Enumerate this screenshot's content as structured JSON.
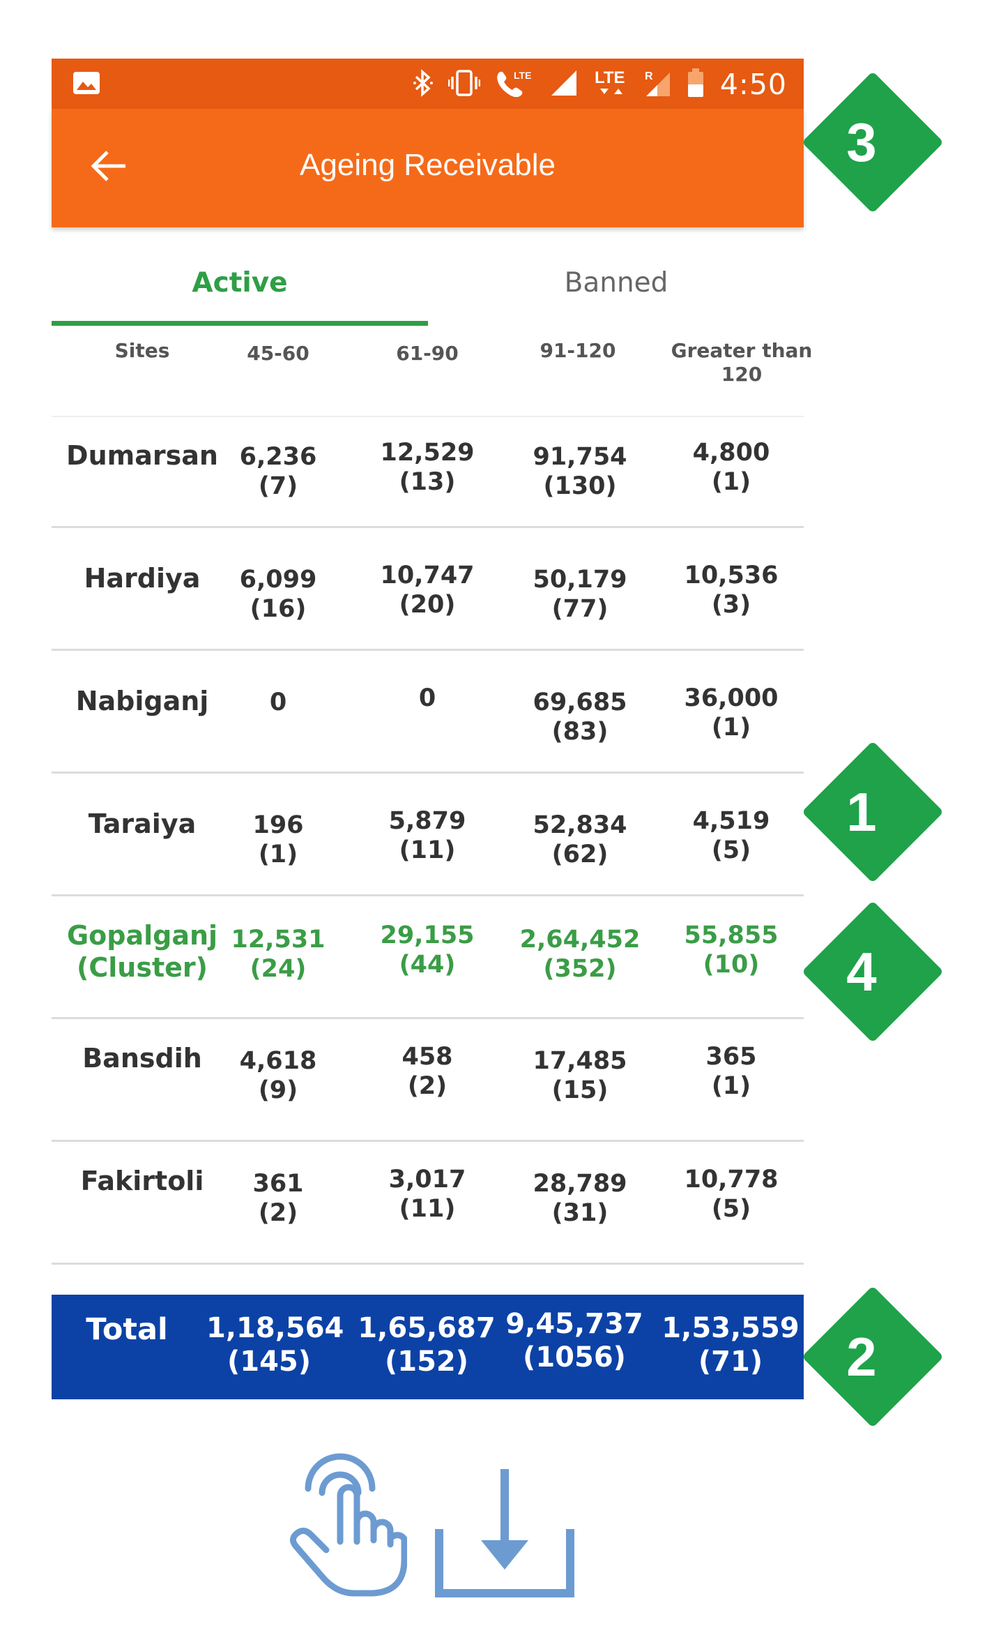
{
  "status_bar": {
    "time": "4:50",
    "icons": [
      "image-icon",
      "bluetooth-icon",
      "vibrate-icon",
      "volte-call-icon",
      "signal-icon",
      "lte-icon",
      "roaming-signal-icon",
      "battery-icon"
    ],
    "lte_label": "LTE",
    "roaming_label": "R"
  },
  "app_bar": {
    "title": "Ageing Receivable",
    "back_icon": "back-arrow-icon",
    "color": "#f56a18"
  },
  "tabs": [
    {
      "label": "Active",
      "active": true
    },
    {
      "label": "Banned",
      "active": false
    }
  ],
  "table": {
    "headers": [
      "Sites",
      "45-60",
      "61-90",
      "91-120",
      "Greater than 120"
    ],
    "header_lines": {
      "gt1": "Greater than",
      "gt2": "120"
    },
    "rows": [
      {
        "site": "Dumarsan",
        "v1": "6,236",
        "c1": "(7)",
        "v2": "12,529",
        "c2": "(13)",
        "v3": "91,754",
        "c3": "(130)",
        "v4": "4,800",
        "c4": "(1)"
      },
      {
        "site": "Hardiya",
        "v1": "6,099",
        "c1": "(16)",
        "v2": "10,747",
        "c2": "(20)",
        "v3": "50,179",
        "c3": "(77)",
        "v4": "10,536",
        "c4": "(3)"
      },
      {
        "site": "Nabiganj",
        "v1": "0",
        "c1": "",
        "v2": "0",
        "c2": "",
        "v3": "69,685",
        "c3": "(83)",
        "v4": "36,000",
        "c4": "(1)"
      },
      {
        "site": "Taraiya",
        "v1": "196",
        "c1": "(1)",
        "v2": "5,879",
        "c2": "(11)",
        "v3": "52,834",
        "c3": "(62)",
        "v4": "4,519",
        "c4": "(5)"
      },
      {
        "site": "Gopalganj",
        "site2": "(Cluster)",
        "v1": "12,531",
        "c1": "(24)",
        "v2": "29,155",
        "c2": "(44)",
        "v3": "2,64,452",
        "c3": "(352)",
        "v4": "55,855",
        "c4": "(10)",
        "highlight": "#3a9d46"
      },
      {
        "site": "Bansdih",
        "v1": "4,618",
        "c1": "(9)",
        "v2": "458",
        "c2": "(2)",
        "v3": "17,485",
        "c3": "(15)",
        "v4": "365",
        "c4": "(1)"
      },
      {
        "site": "Fakirtoli",
        "v1": "361",
        "c1": "(2)",
        "v2": "3,017",
        "c2": "(11)",
        "v3": "28,789",
        "c3": "(31)",
        "v4": "10,778",
        "c4": "(5)"
      }
    ],
    "total": {
      "label": "Total",
      "v1": "1,18,564",
      "c1": "(145)",
      "v2": "1,65,687",
      "c2": "(152)",
      "v3": "9,45,737",
      "c3": "(1056)",
      "v4": "1,53,559",
      "c4": "(71)",
      "color": "#0c42a6"
    }
  },
  "badges": [
    {
      "number": "3",
      "color": "#1fa24a"
    },
    {
      "number": "1",
      "color": "#1fa24a"
    },
    {
      "number": "4",
      "color": "#1fa24a"
    },
    {
      "number": "2",
      "color": "#1fa24a"
    }
  ],
  "bottom_icons": [
    "tap-hand-icon",
    "download-icon"
  ],
  "accent_green": "#2f9e46",
  "icon_blue": "#6c9bd2"
}
